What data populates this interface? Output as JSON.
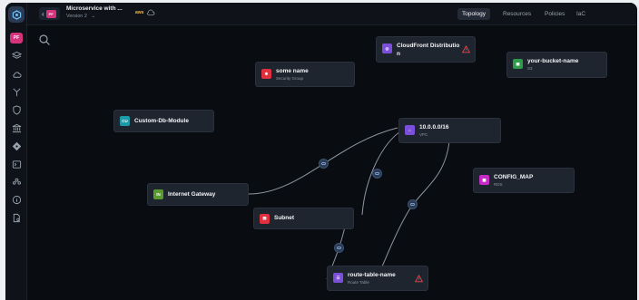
{
  "app": {
    "project_badge": "PF",
    "project_title": "Microservice with ...",
    "project_version": "Version 2",
    "provider_tag": "aws"
  },
  "tabs": [
    {
      "label": "Topology",
      "active": true
    },
    {
      "label": "Resources",
      "active": false
    },
    {
      "label": "Policies",
      "active": false
    },
    {
      "label": "IaC",
      "active": false
    }
  ],
  "rail_icons": [
    "layers-icon",
    "cloud-icon",
    "branch-icon",
    "shield-icon",
    "bank-icon",
    "git-icon",
    "terminal-icon",
    "team-icon",
    "info-icon",
    "document-search-icon"
  ],
  "nodes": {
    "cloudfront": {
      "name_line1": "CloudFront Distributio",
      "name_line2": "n",
      "icon_color": "#7b4fd9",
      "warning": true
    },
    "bucket": {
      "name": "your-bucket-name",
      "type": "S3",
      "icon_color": "#2e9b4b"
    },
    "security_group": {
      "name": "some name",
      "type": "Security Group",
      "icon_color": "#e0303f"
    },
    "custom_db": {
      "name": "Custom-Db-Module",
      "icon_label": "CU",
      "icon_color": "#1b9aaa"
    },
    "vpc": {
      "name": "10.0.0.0/16",
      "type": "VPC",
      "icon_color": "#7b4fd9"
    },
    "config_map": {
      "name": "CONFIG_MAP",
      "type": "RDS",
      "icon_color": "#c72bc7"
    },
    "internet_gateway": {
      "name": "Internet Gateway",
      "icon_label": "IN",
      "icon_color": "#5a9b2e"
    },
    "subnet": {
      "name": "Subnet",
      "icon_color": "#e0303f"
    },
    "route_table": {
      "name": "route-table-name",
      "type": "Route Table",
      "icon_color": "#7b4fd9",
      "warning": true
    }
  },
  "colors": {
    "warning": "#e5484d",
    "edge": "#8d96a2",
    "accent": "#d6337d"
  }
}
